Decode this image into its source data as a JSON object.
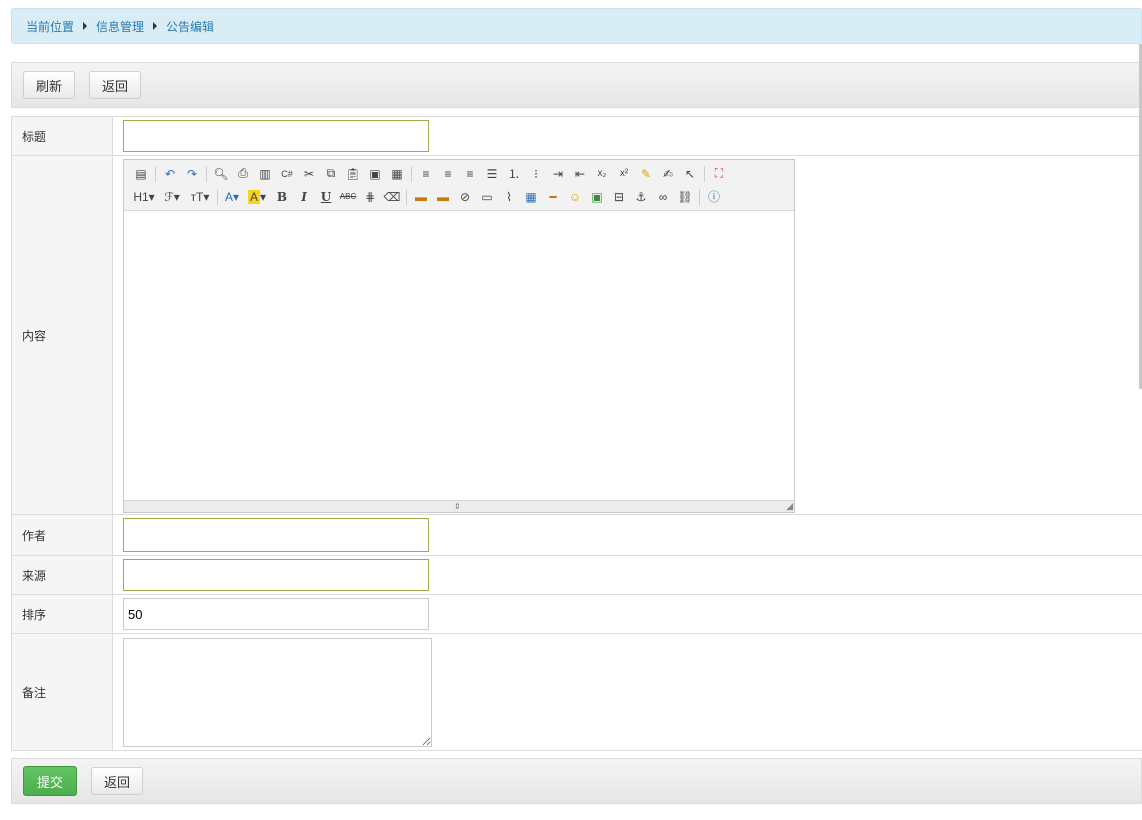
{
  "breadcrumb": {
    "items": [
      "当前位置",
      "信息管理",
      "公告编辑"
    ]
  },
  "top_toolbar": {
    "refresh_label": "刷新",
    "back_label": "返回"
  },
  "form": {
    "title_label": "标题",
    "title_value": "",
    "content_label": "内容",
    "author_label": "作者",
    "author_value": "",
    "source_label": "来源",
    "source_value": "",
    "order_label": "排序",
    "order_value": "50",
    "remark_label": "备注",
    "remark_value": ""
  },
  "editor_toolbar": {
    "row1": [
      "source-icon",
      "undo-icon",
      "redo-icon",
      "preview-icon",
      "print-icon",
      "template-icon",
      "code-icon",
      "cut-icon",
      "copy-icon",
      "paste-icon",
      "paste-text-icon",
      "paste-word-icon",
      "align-left-icon",
      "align-center-icon",
      "align-right-icon",
      "align-justify-icon",
      "ordered-list-icon",
      "unordered-list-icon",
      "indent-icon",
      "outdent-icon",
      "subscript-icon",
      "superscript-icon",
      "clear-format-icon",
      "quick-format-icon",
      "select-all-icon",
      "fullscreen-icon"
    ],
    "row2": [
      "heading-icon",
      "font-family-icon",
      "font-size-icon",
      "font-color-icon",
      "highlight-color-icon",
      "bold-icon",
      "italic-icon",
      "underline-icon",
      "strikethrough-icon",
      "line-height-icon",
      "remove-format-icon",
      "image-icon",
      "multi-image-icon",
      "flash-icon",
      "media-icon",
      "attachment-icon",
      "table-icon",
      "hr-icon",
      "emoticon-icon",
      "baidu-map-icon",
      "page-break-icon",
      "anchor-icon",
      "link-icon",
      "unlink-icon",
      "help-icon"
    ],
    "heading_text": "H1",
    "bold_text": "B",
    "italic_text": "I",
    "underline_text": "U",
    "strike_text": "ABC"
  },
  "bottom_toolbar": {
    "submit_label": "提交",
    "back_label": "返回"
  }
}
